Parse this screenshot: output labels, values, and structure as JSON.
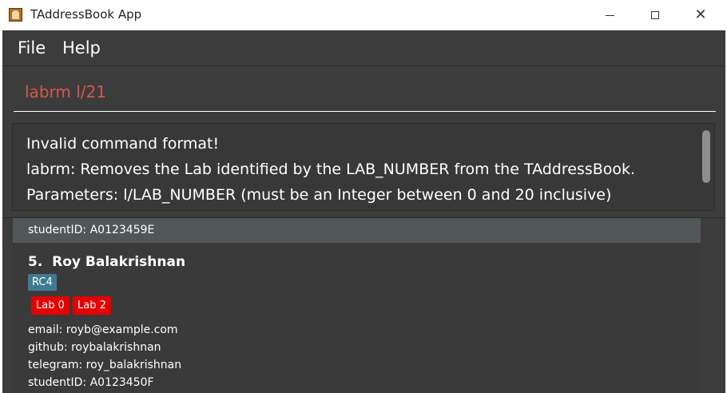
{
  "window": {
    "title": "TAddressBook App",
    "icon": "address-book-icon"
  },
  "menu": {
    "file": "File",
    "help": "Help"
  },
  "command": {
    "text": "labrm l/21"
  },
  "result": {
    "line1": "Invalid command format!",
    "line2": "labrm: Removes the Lab identified by the LAB_NUMBER from the TAddressBook.",
    "line3": "Parameters: l/LAB_NUMBER (must be an Integer between 0 and 20 inclusive)"
  },
  "list": {
    "previous_partial": "studentID: A0123459E",
    "person": {
      "index": "5.",
      "name": "Roy Balakrishnan",
      "tag": "RC4",
      "labs": [
        "Lab 0",
        "Lab 2"
      ],
      "email": "email: royb@example.com",
      "github": "github: roybalakrishnan",
      "telegram": "telegram: roy_balakrishnan",
      "studentId": "studentID: A0123450F"
    }
  },
  "colors": {
    "command_text": "#d9574a",
    "lab_tag": "#e50000",
    "group_tag": "#3e7b91",
    "background": "#3c3c3c"
  }
}
